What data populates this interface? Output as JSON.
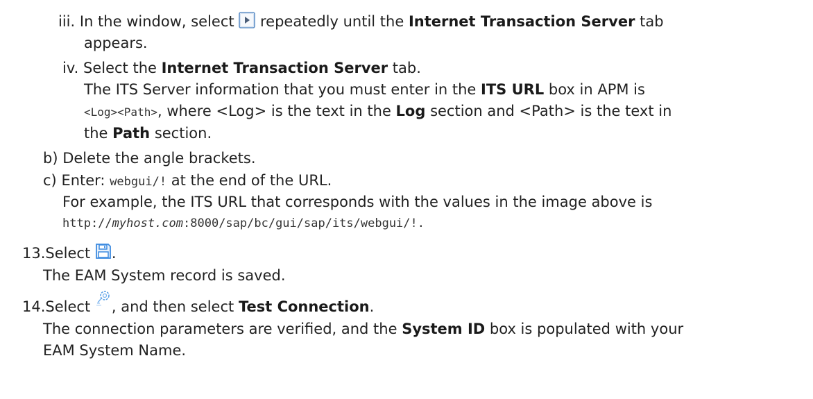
{
  "steps": {
    "iii": {
      "marker": "iii.",
      "text_before": "In the window, select ",
      "text_after": " repeatedly until the ",
      "bold": "Internet Transaction Server",
      "text_end": " tab",
      "cont": "appears.",
      "icon": "next-arrow-icon"
    },
    "iv": {
      "marker": "iv.",
      "text_before": "Select the ",
      "bold": "Internet Transaction Server",
      "text_end": " tab.",
      "p1_before": "The ITS Server information that you must enter in the ",
      "p1_bold": "ITS URL",
      "p1_after": " box in APM is",
      "p2_code": "<Log><Path>",
      "p2_mid": ", where <Log> is the text in the ",
      "p2_bold": "Log",
      "p2_after": " section and <Path> is the text in",
      "p3_before": "the ",
      "p3_bold": "Path",
      "p3_after": " section."
    },
    "b": {
      "marker": "b)",
      "text": "Delete the angle brackets."
    },
    "c": {
      "marker": "c)",
      "text_before": "Enter: ",
      "code": "webgui/!",
      "text_after": " at the end of the URL.",
      "example": "For example, the ITS URL that corresponds with the values in the image above is",
      "url_prefix": "http://",
      "url_host": "myhost.com",
      "url_rest": ":8000/sap/bc/gui/sap/its/webgui/!",
      "url_end": "."
    },
    "s13": {
      "marker": "13.",
      "text_before": "Select ",
      "text_after": ".",
      "result": "The EAM System record is saved.",
      "icon": "save-disk-icon"
    },
    "s14": {
      "marker": "14.",
      "text_before": "Select ",
      "text_mid": ", and then select ",
      "bold": "Test Connection",
      "text_end": ".",
      "r1_before": "The connection parameters are verified, and the ",
      "r1_bold": "System ID",
      "r1_after": " box is populated with your",
      "r2": "EAM System Name.",
      "icon": "connection-icon"
    }
  },
  "colors": {
    "text": "#222222",
    "icon_blue": "#4a90d9"
  }
}
